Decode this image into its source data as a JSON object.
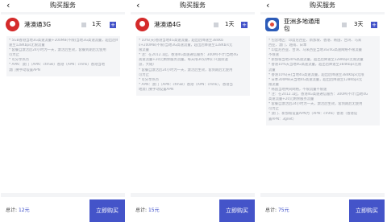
{
  "panels": [
    {
      "back_icon": "‹",
      "title": "购买服务",
      "product": "港澳通3G",
      "days": "1天",
      "plus": "+",
      "description": [
        "* 5GB香港当地3G高速流量+200MB(不限)当地3G高速流量，超出后降",
        "速至128Kbps无限流量",
        "* 套餐自激活后24小时为一天，激活后生效，套餐到期后无使用",
        "可为止",
        "* 可分享热点",
        "* APN：澳门（APN：ctmwl）香港（APN：cmhk）香港当地",
        "澳门要手动设置APN"
      ],
      "total_label": "总计:",
      "total_price": "12元",
      "buy_label": "立即购买"
    },
    {
      "back_icon": "‹",
      "title": "购买服务",
      "product": "港澳通4G",
      "days": "1天",
      "plus": "+",
      "description": [
        "* 10%(天)香港当地4G高速流量，超出后降速至384Kb",
        "s+200MB(不限)当地3G高速流量，超出后降速至128Kb/s无",
        "限流量",
        "* 注：在2012.1起，香港4G高速通信服务：300M(不计)当地4G",
        "高速流量+20元剩余服务流量。每天限30分钟以下(国际漫",
        "游，大陆)",
        "* 套餐自激活后24小时为一天，激活后生效，套到期后无使用",
        "可为止",
        "* 可分享热点",
        "* APN：澳门（APN：ctmwl）香港（APN：cmhk），香港当",
        "地澳门要手动设置APN"
      ],
      "total_label": "总计:",
      "total_price": "15元",
      "buy_label": "立即购买"
    },
    {
      "back_icon": "‹",
      "title": "购买服务",
      "product": "亚洲多地通用包",
      "days": "3天",
      "plus": "+",
      "description": [
        "* 包含地区：印度尼西亚、新加坡、香港、韩国、台湾、马来",
        "西亚、澳门、越南、日本",
        "* 印度尼西亚、台湾、马来西亚当地3G/4G高速网络不限流量",
        "不限速",
        "* 新加坡当地30%高速流量，超出后降速至128Kbps无限流量",
        "* 香港10%天当地4G高速流量，超出后降速至384Kbps无限",
        "流量",
        "* 香港10%(天)当地4G高速流量，超出后降速至384Kbps无限",
        "* 日本300MB天当地4G高速流量，超出后降速至128Kbps无",
        "限流量",
        "* 韩国当地共同网络，不限流量不限速",
        "* 注：在2012.1起，香港4G高速通信服务：300M(不计)当地4G",
        "高速流量+20元剩余服务流量",
        "* 套餐自激活后24小时为一天，激活后生效，套到期后无使用",
        "可为止",
        "* 澳门、新加坡设置APN为（APN：cmhk）香港（香港设",
        "置APN：3gnet）"
      ],
      "total_label": "总计:",
      "total_price": "75元",
      "buy_label": "立即购买"
    }
  ]
}
